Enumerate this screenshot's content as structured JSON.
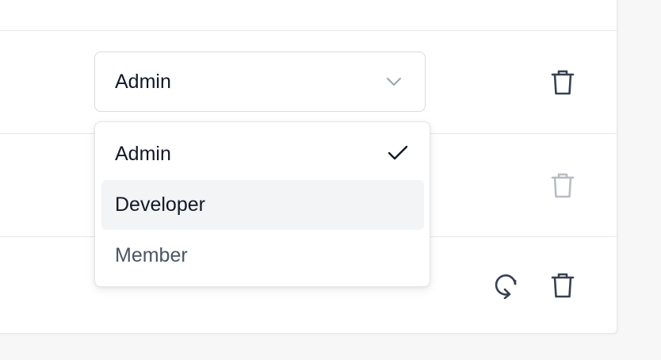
{
  "role_select": {
    "value": "Admin",
    "chevron_icon": "chevron-down-icon"
  },
  "role_dropdown": {
    "options": [
      {
        "label": "Admin",
        "selected": true,
        "color": "#111827"
      },
      {
        "label": "Developer",
        "selected": false,
        "highlighted": true,
        "color": "#111827"
      },
      {
        "label": "Member",
        "selected": false,
        "color": "#4b5563"
      }
    ],
    "check_icon": "check-icon"
  },
  "row_actions": {
    "delete_icon": "trash-icon",
    "resend_icon": "refresh-icon",
    "icon_color": "#374151",
    "disabled_icon_color": "#b8bcc4"
  },
  "colors": {
    "background": "#f7f7f8",
    "panel": "#ffffff",
    "border": "#e5e7eb"
  }
}
